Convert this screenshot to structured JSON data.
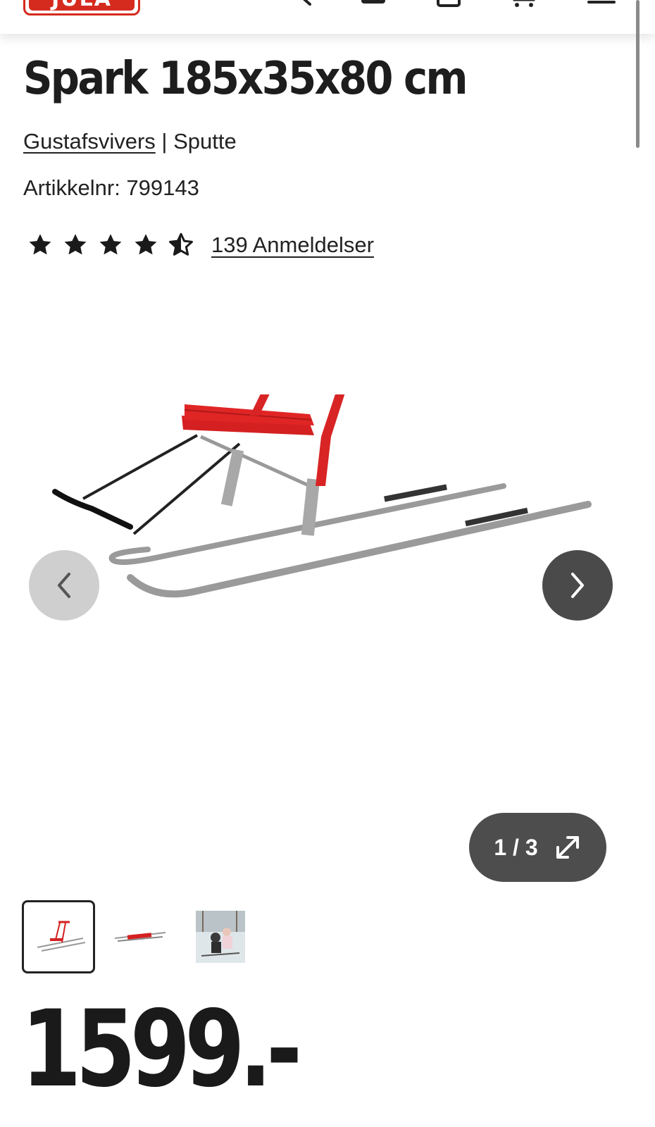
{
  "header": {
    "logo_text": "JULA",
    "brand_color": "#d52b1e"
  },
  "product": {
    "title": "Spark 185x35x80 cm",
    "brand": "Gustafsvivers",
    "separator": " | ",
    "category": "Sputte",
    "article_label": "Artikkelnr: 799143",
    "rating": {
      "stars": 4.5,
      "max": 5,
      "reviews_label": "139 Anmeldelser"
    }
  },
  "gallery": {
    "counter": "1 / 3",
    "current": 1,
    "total": 3,
    "thumbnails": [
      "kicksled-side",
      "kicksled-flat",
      "kicksled-in-snow"
    ]
  },
  "price": {
    "value": "1599.-"
  }
}
